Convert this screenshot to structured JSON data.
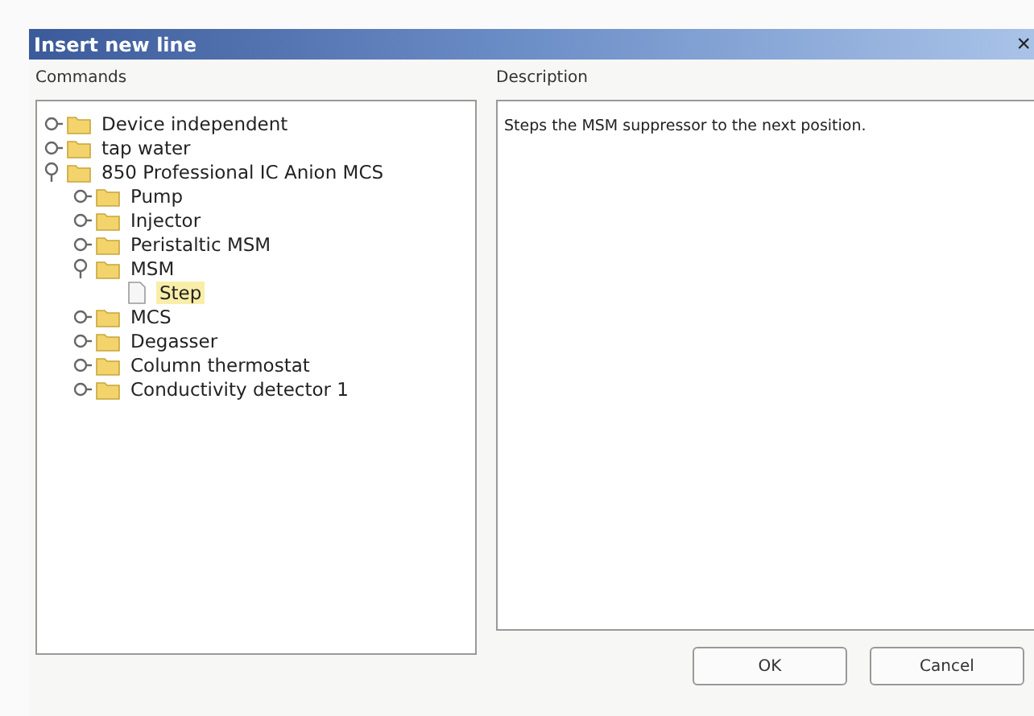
{
  "window": {
    "title": "Insert new line",
    "close": "×"
  },
  "commands": {
    "label": "Commands",
    "tree": [
      {
        "label": "Device independent",
        "kind": "folder",
        "expanded": false,
        "selected": false
      },
      {
        "label": "tap water",
        "kind": "folder",
        "expanded": false,
        "selected": false
      },
      {
        "label": "850 Professional IC Anion MCS",
        "kind": "folder",
        "expanded": true,
        "selected": false,
        "children": [
          {
            "label": "Pump",
            "kind": "folder",
            "expanded": false,
            "selected": false
          },
          {
            "label": "Injector",
            "kind": "folder",
            "expanded": false,
            "selected": false
          },
          {
            "label": "Peristaltic MSM",
            "kind": "folder",
            "expanded": false,
            "selected": false
          },
          {
            "label": "MSM",
            "kind": "folder",
            "expanded": true,
            "selected": false,
            "children": [
              {
                "label": "Step",
                "kind": "command",
                "selected": true
              }
            ]
          },
          {
            "label": "MCS",
            "kind": "folder",
            "expanded": false,
            "selected": false
          },
          {
            "label": "Degasser",
            "kind": "folder",
            "expanded": false,
            "selected": false
          },
          {
            "label": "Column thermostat",
            "kind": "folder",
            "expanded": false,
            "selected": false
          },
          {
            "label": "Conductivity detector 1",
            "kind": "folder",
            "expanded": false,
            "selected": false
          }
        ]
      }
    ]
  },
  "description": {
    "label": "Description",
    "text": "Steps the MSM suppressor to the next position."
  },
  "buttons": [
    "OK",
    "Cancel"
  ]
}
